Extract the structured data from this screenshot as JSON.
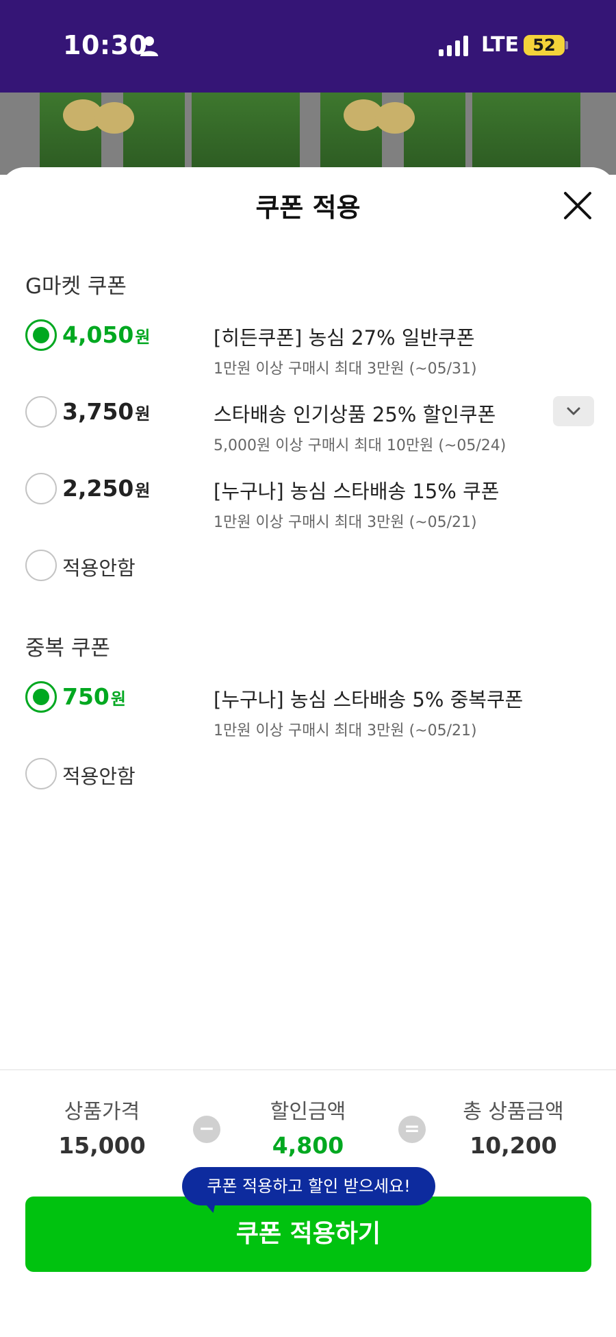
{
  "status_bar": {
    "time": "10:30",
    "network": "LTE",
    "battery": "52",
    "icons": [
      "person-icon",
      "signal-icon"
    ]
  },
  "sheet": {
    "title": "쿠폰 적용",
    "close_icon": "close-icon"
  },
  "gmarket_section": {
    "title": "G마켓 쿠폰",
    "options": [
      {
        "amount": "4,050",
        "unit": "원",
        "name": "[히든쿠폰] 농심 27% 일반쿠폰",
        "desc": "1만원 이상 구매시 최대 3만원 (~05/31)",
        "selected": true
      },
      {
        "amount": "3,750",
        "unit": "원",
        "name": "스타배송 인기상품 25% 할인쿠폰",
        "desc": "5,000원 이상 구매시 최대 10만원 (~05/24)",
        "selected": false
      },
      {
        "amount": "2,250",
        "unit": "원",
        "name": "[누구나] 농심 스타배송 15% 쿠폰",
        "desc": "1만원 이상 구매시 최대 3만원 (~05/21)",
        "selected": false
      }
    ],
    "none_label": "적용안함"
  },
  "duplicate_section": {
    "title": "중복 쿠폰",
    "options": [
      {
        "amount": "750",
        "unit": "원",
        "name": "[누구나] 농심 스타배송 5% 중복쿠폰",
        "desc": "1만원 이상 구매시 최대 3만원 (~05/21)",
        "selected": true
      }
    ],
    "none_label": "적용안함"
  },
  "summary": {
    "price_label": "상품가격",
    "price_value": "15,000",
    "minus_symbol": "−",
    "discount_label": "할인금액",
    "discount_value": "4,800",
    "equals_symbol": "=",
    "total_label": "총 상품금액",
    "total_value": "10,200"
  },
  "tooltip": "쿠폰 적용하고 할인 받으세요!",
  "apply_button": "쿠폰 적용하기",
  "colors": {
    "status_bar": "#351576",
    "accent_green": "#00a820",
    "button_green": "#00c20f",
    "tooltip_blue": "#0d2b9e"
  }
}
